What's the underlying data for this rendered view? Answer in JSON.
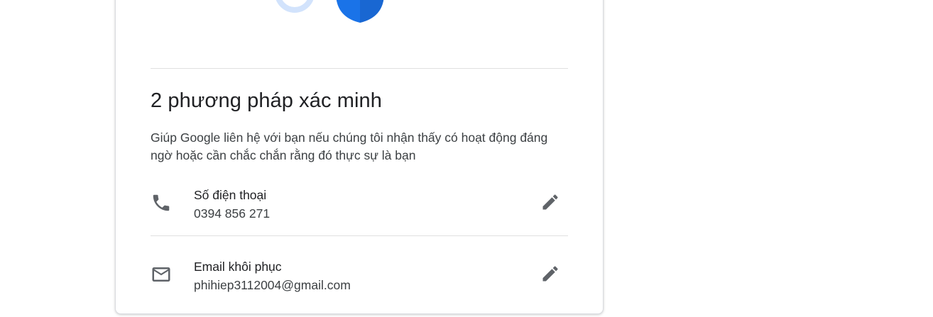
{
  "section": {
    "title": "2 phương pháp xác minh",
    "description": "Giúp Google liên hệ với bạn nếu chúng tôi nhận thấy có hoạt động đáng ngờ hoặc cần chắc chắn rằng đó thực sự là bạn"
  },
  "methods": [
    {
      "label": "Số điện thoại",
      "value": "0394 856 271",
      "icon": "phone-icon",
      "action_icon": "edit-pencil-icon"
    },
    {
      "label": "Email khôi phục",
      "value": "phihiep3112004@gmail.com",
      "icon": "mail-icon",
      "action_icon": "edit-pencil-icon"
    }
  ],
  "colors": {
    "accent_blue": "#1a73e8",
    "light_blue": "#d2e3fc",
    "icon_gray": "#5f6368",
    "divider": "#e0e0e0"
  }
}
